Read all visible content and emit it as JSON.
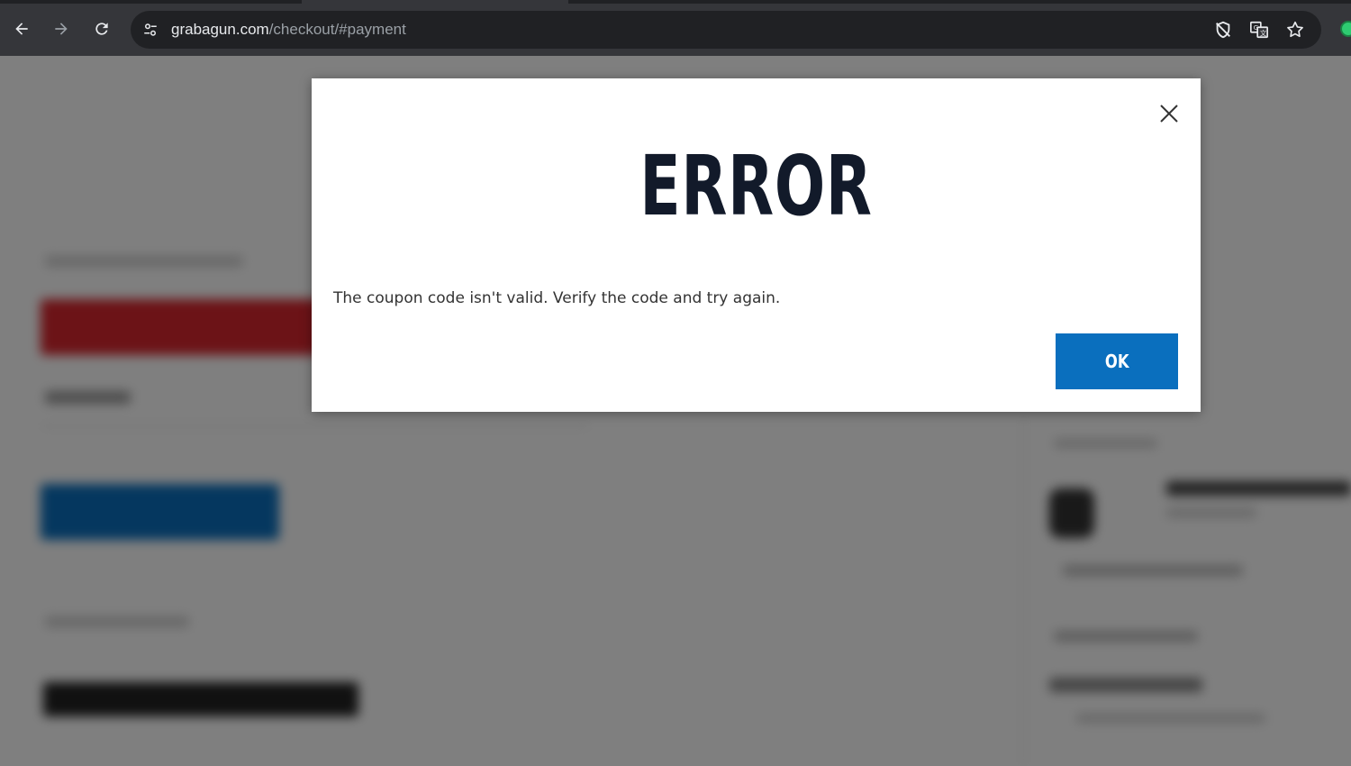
{
  "browser": {
    "url_host": "grabagun.com",
    "url_path": "/checkout/#payment",
    "icons": {
      "back": "arrow-left-icon",
      "forward": "arrow-right-icon",
      "reload": "reload-icon",
      "site_info": "tune-icon",
      "tracking": "eye-off-icon",
      "translate": "translate-icon",
      "bookmark": "star-icon",
      "extension": "extension-icon"
    }
  },
  "modal": {
    "title": "ERROR",
    "message": "The coupon code isn't valid. Verify the code and try again.",
    "ok_label": "OK",
    "close_icon": "close-icon"
  },
  "colors": {
    "ok_button": "#0a6fbe",
    "title_text": "#121a2a",
    "overlay": "rgba(0,0,0,0.5)"
  }
}
